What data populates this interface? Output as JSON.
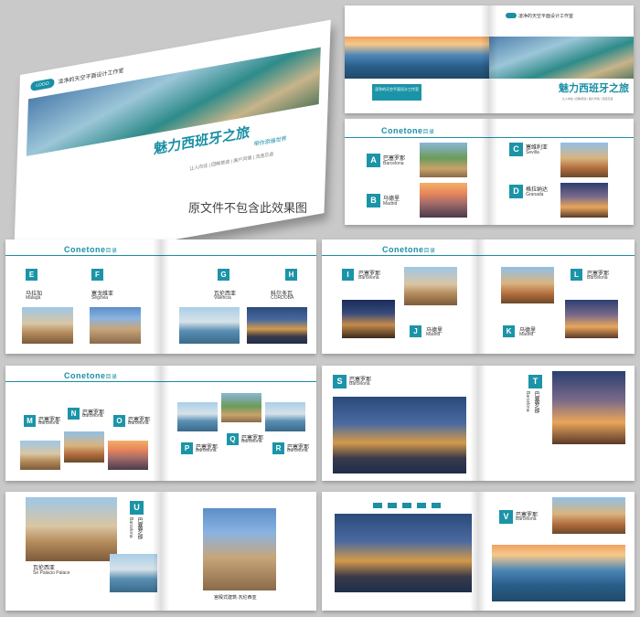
{
  "cover": {
    "studio": "凌净的天空平面设计工作室",
    "logo": "LOGO",
    "title": "魅力西班牙之旅",
    "subtitle": "带你游遍世界",
    "tagline": "让人向往 | 回眸旅途 | 美户风情 | 流连忘返"
  },
  "notice": "原文件不包含此效果图",
  "spread1": {
    "studio": "凌净的天空平面设计工作室",
    "title": "魅力西班牙之旅",
    "caption_left": "凌净的天空平面设计工作室",
    "footer_right": "让人向往 | 回眸旅途 | 美户风情 | 流连忘返"
  },
  "toc_heading": "Conetone",
  "toc_suffix": "目录",
  "toc1": [
    {
      "letter": "A",
      "cn": "巴塞罗那",
      "en": "Barcelona"
    },
    {
      "letter": "B",
      "cn": "马德里",
      "en": "Madrid"
    },
    {
      "letter": "C",
      "cn": "塞维利亚",
      "en": "Sevilla"
    },
    {
      "letter": "D",
      "cn": "格拉纳达",
      "en": "Granada"
    }
  ],
  "toc2": [
    {
      "letter": "E",
      "cn": "马拉加",
      "en": "Malaga"
    },
    {
      "letter": "F",
      "cn": "塞戈维亚",
      "en": "Segovia"
    },
    {
      "letter": "G",
      "cn": "瓦伦西亚",
      "en": "Valencia"
    },
    {
      "letter": "H",
      "cn": "科尔多瓦",
      "en": "CORDOBA"
    }
  ],
  "toc3": [
    {
      "letter": "I",
      "cn": "巴塞罗那",
      "en": "Barcelona"
    },
    {
      "letter": "J",
      "cn": "马德里",
      "en": "Madrid"
    },
    {
      "letter": "K",
      "cn": "马德里",
      "en": "Madrid"
    },
    {
      "letter": "L",
      "cn": "巴塞罗那",
      "en": "Barcelona"
    }
  ],
  "toc4": [
    {
      "letter": "M",
      "cn": "巴塞罗那",
      "en": "Barcelona"
    },
    {
      "letter": "N",
      "cn": "巴塞罗那",
      "en": "Barcelona"
    },
    {
      "letter": "O",
      "cn": "巴塞罗那",
      "en": "Barcelona"
    },
    {
      "letter": "P",
      "cn": "巴塞罗那",
      "en": "Barcelona"
    },
    {
      "letter": "Q",
      "cn": "巴塞罗那",
      "en": "Barcelona"
    },
    {
      "letter": "R",
      "cn": "巴塞罗那",
      "en": "Barcelona"
    }
  ],
  "spread_st": {
    "s_letter": "S",
    "s_cn": "巴塞罗那",
    "s_en": "Barcelona",
    "t_letter": "T",
    "t_cn": "巴塞罗那",
    "t_en": "Barcelona"
  },
  "spread_u": {
    "letter": "U",
    "cn": "巴塞罗那",
    "en": "Barcelona",
    "place_cn": "瓦伦西亚",
    "place_en": "Se Palacio Palace",
    "caption": "宫殿式建筑·瓦伦西亚"
  },
  "spread_v": {
    "letter": "V",
    "cn": "巴塞罗那",
    "en": "Barcelona"
  }
}
